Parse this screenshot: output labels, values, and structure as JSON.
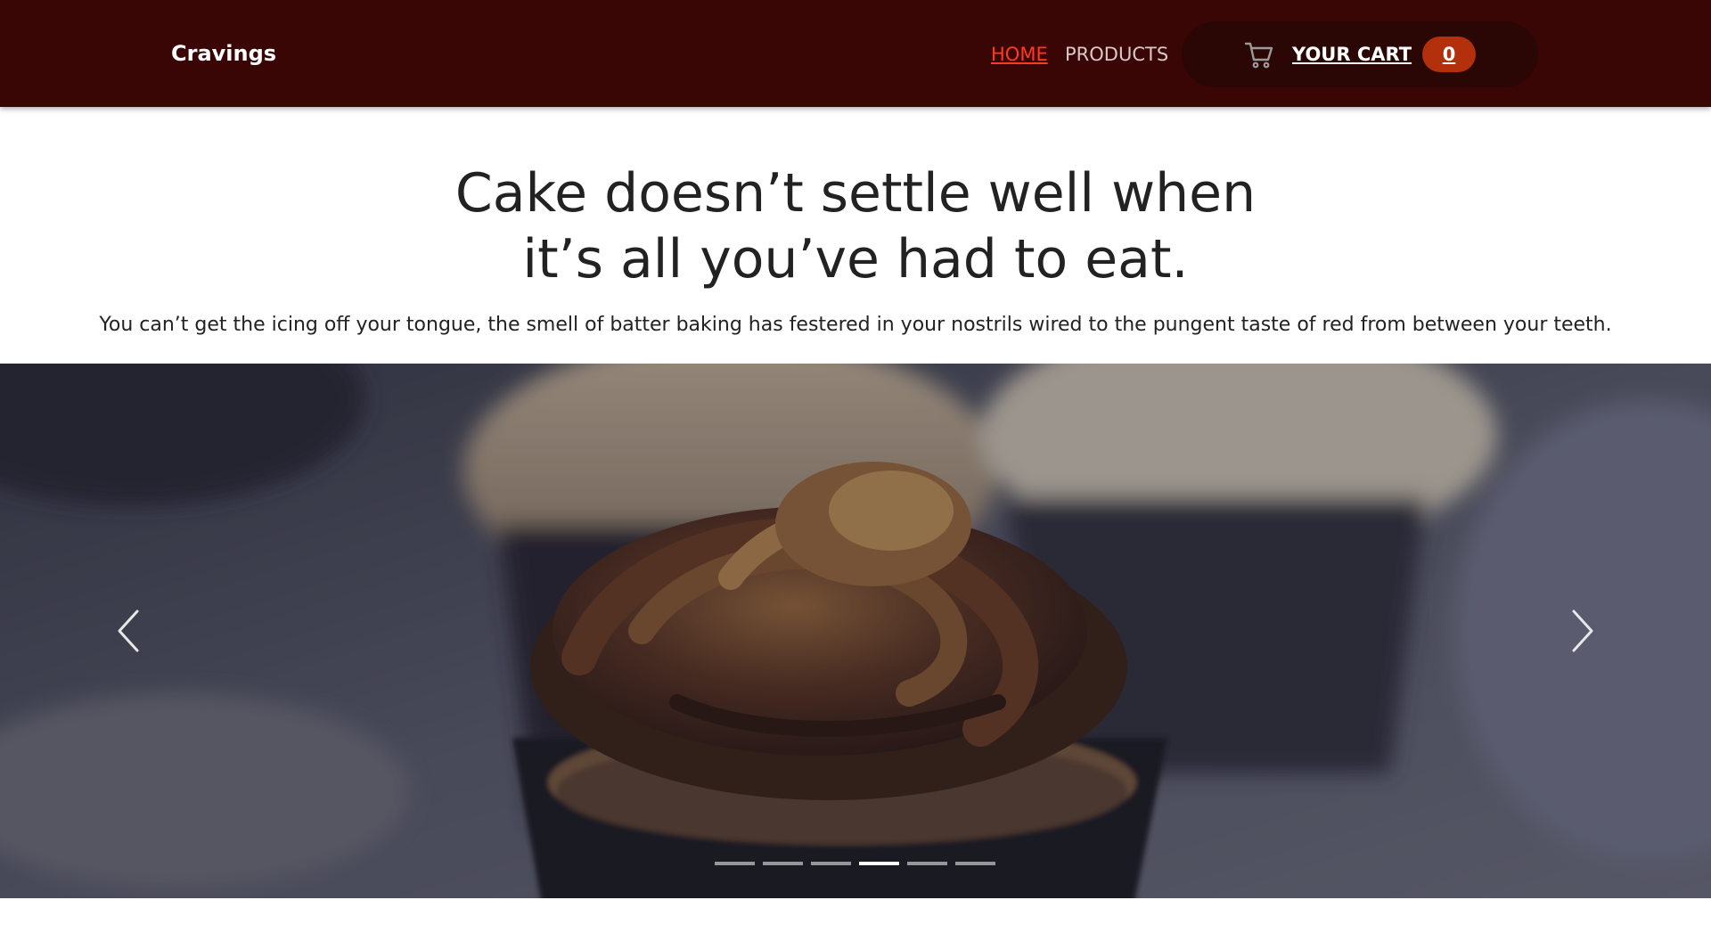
{
  "navbar": {
    "brand": "Cravings",
    "links": [
      {
        "label": "HOME",
        "active": true
      },
      {
        "label": "PRODUCTS",
        "active": false
      }
    ],
    "cart": {
      "label": "YOUR CART",
      "count": "0",
      "icon": "cart-icon"
    }
  },
  "hero": {
    "title_line1": "Cake doesn’t settle well when",
    "title_line2": "it’s all you’ve had to eat.",
    "subtitle": "You can’t get the icing off your tongue, the smell of batter baking has festered in your nostrils wired to the pungent taste of red from between your teeth."
  },
  "carousel": {
    "prev_icon": "chevron-left-icon",
    "next_icon": "chevron-right-icon",
    "slides_count": 6,
    "active_slide": 4
  },
  "colors": {
    "navbar_bg": "#3a0505",
    "active_link": "#ff3b1f",
    "cart_pill_bg": "#2a0704",
    "cart_badge": "#b3300c"
  }
}
